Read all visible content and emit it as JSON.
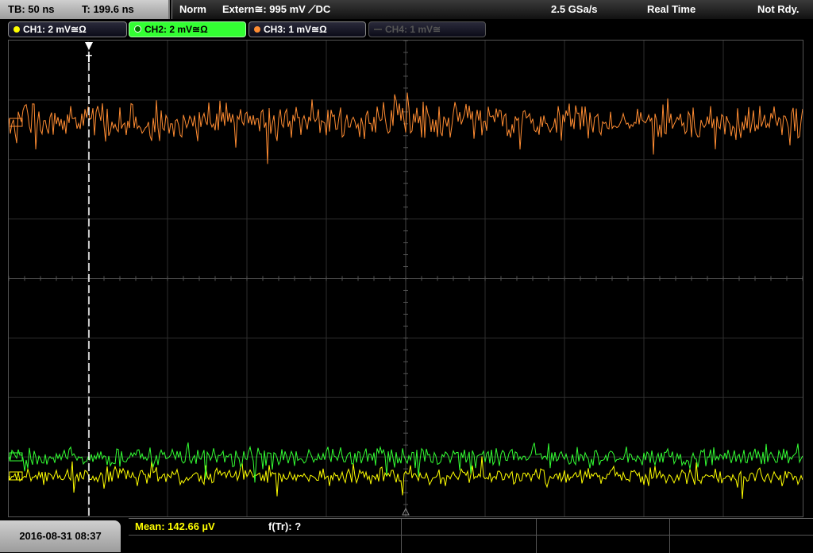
{
  "top_bar": {
    "timebase": "TB: 50 ns",
    "trigger_pos": "T: 199.6 ns",
    "mode": "Norm",
    "trigger_source": "Extern≅: 995 mV ⟋DC",
    "sample_rate": "2.5 GSa/s",
    "acq_mode": "Real Time",
    "status": "Not Rdy."
  },
  "channels": [
    {
      "label": "CH1: 2 mV≅Ω",
      "color": "#ffff00"
    },
    {
      "label": "CH2: 2 mV≅Ω",
      "color": "#33ff33"
    },
    {
      "label": "CH3: 1 mV≅Ω",
      "color": "#ff8c32"
    },
    {
      "label": "CH4: 1 mV≅",
      "color": "#555555"
    }
  ],
  "display": {
    "grid_color": "#2e2e2e",
    "trigger_marker_color": "#ffffff",
    "trigger_glyph": "T"
  },
  "bottom_bar": {
    "datetime": "2016-08-31 08:37",
    "measurement_mean": "Mean: 142.66 µV",
    "measurement_ftr": "f(Tr): ?"
  }
}
